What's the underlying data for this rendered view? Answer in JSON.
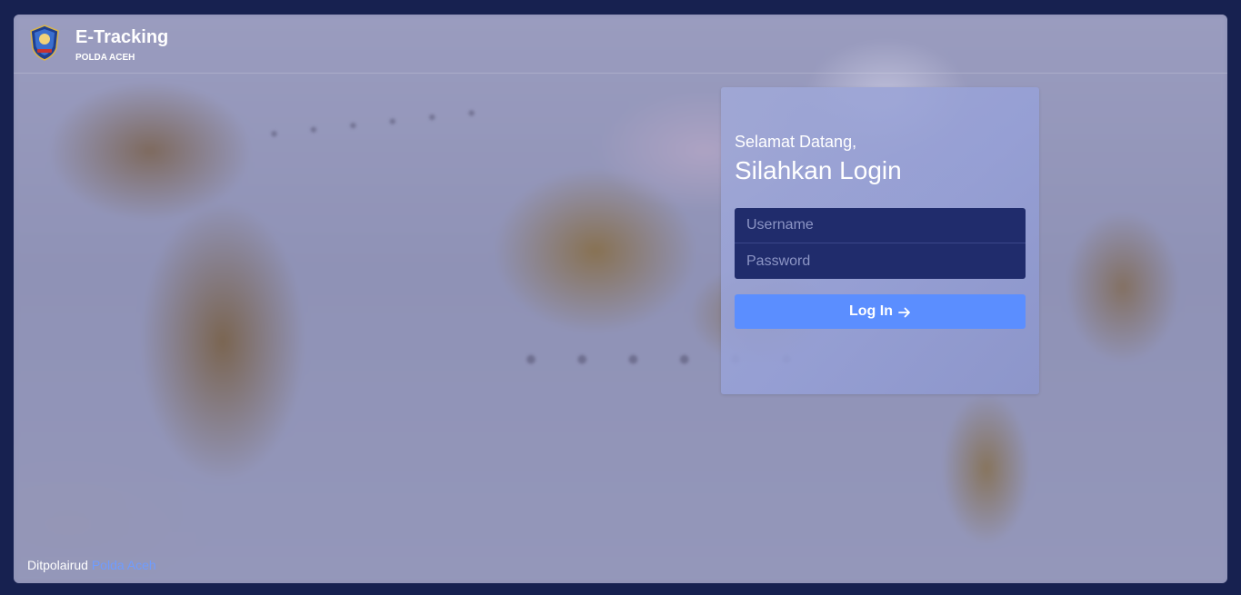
{
  "app": {
    "title": "E-Tracking",
    "subtitle": "POLDA ACEH",
    "logo_icon": "polda-aceh-badge-icon"
  },
  "login": {
    "greeting": "Selamat Datang,",
    "title": "Silahkan Login",
    "username_placeholder": "Username",
    "password_placeholder": "Password",
    "button_label": "Log In",
    "button_icon": "arrow-right-icon"
  },
  "footer": {
    "text": "Ditpolairud",
    "link_label": "Polda Aceh"
  },
  "colors": {
    "page_border": "#172150",
    "input_bg": "#202c6c",
    "button_bg": "#5b8eff",
    "link": "#6f9cff"
  }
}
